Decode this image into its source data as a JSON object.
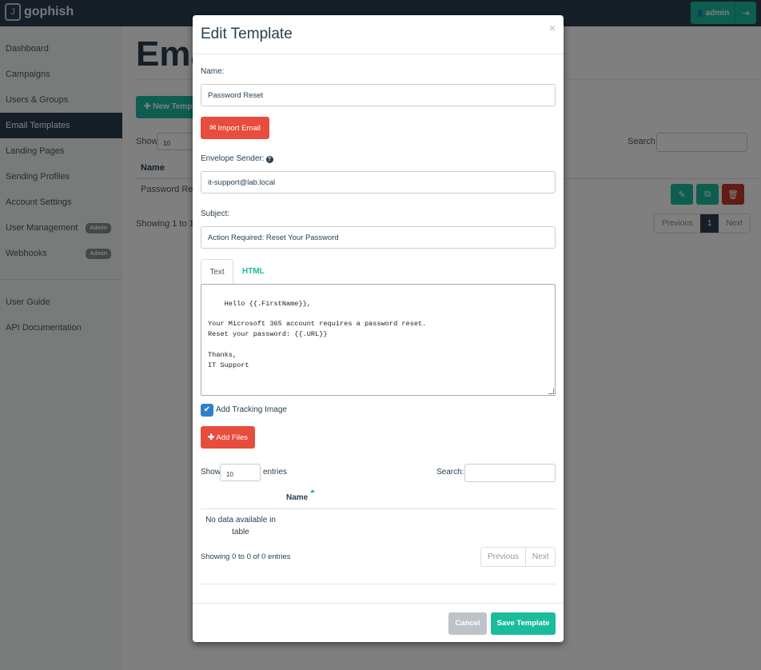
{
  "brand": {
    "logo_letter": "J",
    "name": "gophish"
  },
  "topbar": {
    "user_label": "admin",
    "user_icon": "👤",
    "logout_icon": "⇥"
  },
  "sidebar": {
    "items": [
      {
        "label": "Dashboard"
      },
      {
        "label": "Campaigns"
      },
      {
        "label": "Users & Groups"
      },
      {
        "label": "Email Templates",
        "active": true
      },
      {
        "label": "Landing Pages"
      },
      {
        "label": "Sending Profiles"
      },
      {
        "label": "Account Settings"
      },
      {
        "label": "User Management",
        "badge": "Admin"
      },
      {
        "label": "Webhooks",
        "badge": "Admin"
      }
    ],
    "links": [
      {
        "label": "User Guide"
      },
      {
        "label": "API Documentation"
      }
    ]
  },
  "page": {
    "title": "Ema",
    "new_button": "✚ New Templa",
    "show_label": "Show",
    "show_value": "10",
    "search_label": "Search:",
    "col_name": "Name",
    "row_name": "Password Rese",
    "showing_text": "Showing 1 to 1 o",
    "pager": {
      "prev": "Previous",
      "current": "1",
      "next": "Next"
    }
  },
  "modal": {
    "title": "Edit Template",
    "close": "×",
    "name_label": "Name:",
    "name_value": "Password Reset",
    "import_button": "Import Email",
    "envelope_label": "Envelope Sender:",
    "envelope_value": "it-support@lab.local",
    "subject_label": "Subject:",
    "subject_value": "Action Required: Reset Your Password",
    "tabs": {
      "text": "Text",
      "html": "HTML"
    },
    "body_text": "Hello {{.FirstName}},\n\nYour Microsoft 365 account requires a password reset.\nReset your password: {{.URL}}\n\nThanks,\nIT Support",
    "tracking_label": "Add Tracking Image",
    "tracking_checked": true,
    "add_files_button": "Add Files",
    "files_table": {
      "show_label": "Show",
      "show_value": "10",
      "entries_label": "entries",
      "search_label": "Search:",
      "col_name": "Name",
      "no_data": "No data available in table",
      "showing_text": "Showing 0 to 0 of 0 entries",
      "prev": "Previous",
      "next": "Next"
    },
    "cancel_button": "Cancel",
    "save_button": "Save Template"
  },
  "colors": {
    "navy": "#2c3e50",
    "teal": "#1abc9c",
    "red": "#e74c3c",
    "blue_checkbox": "#2e80c8"
  }
}
